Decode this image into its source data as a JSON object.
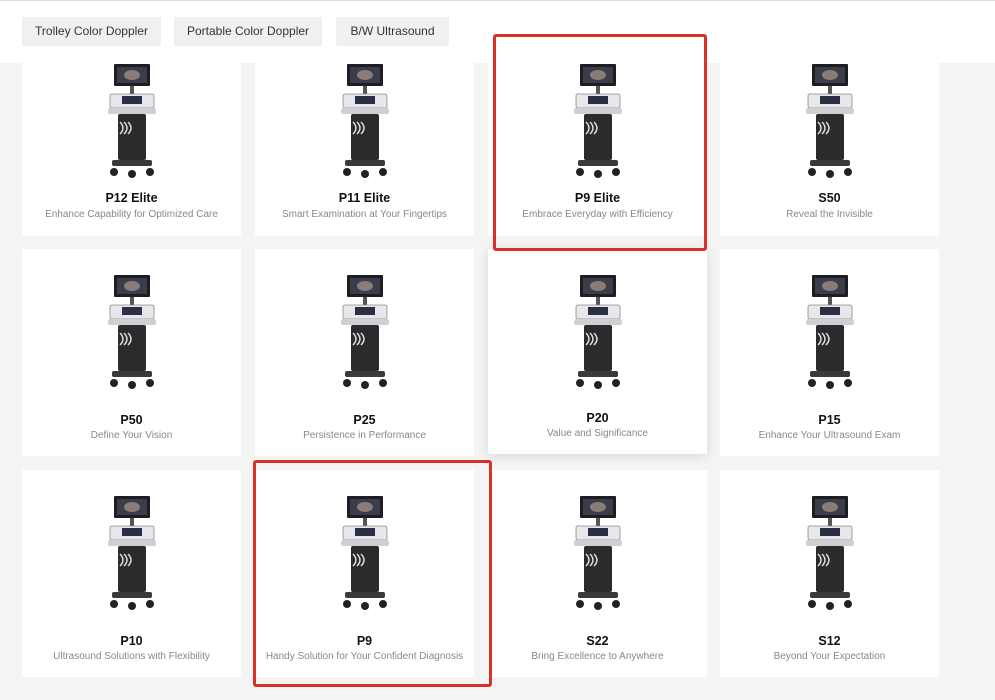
{
  "tabs": [
    "Trolley Color Doppler",
    "Portable Color Doppler",
    "B/W Ultrasound"
  ],
  "products": [
    {
      "name": "P12 Elite",
      "desc": "Enhance Capability for Optimized Care"
    },
    {
      "name": "P11 Elite",
      "desc": "Smart Examination at Your Fingertips"
    },
    {
      "name": "P9 Elite",
      "desc": "Embrace Everyday with Efficiency"
    },
    {
      "name": "S50",
      "desc": "Reveal the Invisible"
    },
    {
      "name": "P50",
      "desc": "Define Your Vision"
    },
    {
      "name": "P25",
      "desc": "Persistence in Performance"
    },
    {
      "name": "P20",
      "desc": "Value and Significance"
    },
    {
      "name": "P15",
      "desc": "Enhance Your Ultrasound Exam"
    },
    {
      "name": "P10",
      "desc": "Ultrasound Solutions with Flexibility"
    },
    {
      "name": "P9",
      "desc": "Handy Solution for Your Confident Diagnosis"
    },
    {
      "name": "S22",
      "desc": "Bring Excellence to Anywhere"
    },
    {
      "name": "S12",
      "desc": "Beyond Your Expectation"
    }
  ],
  "colors": {
    "highlight": "#d9302b",
    "background": "#f4f4f4",
    "card": "#ffffff"
  }
}
